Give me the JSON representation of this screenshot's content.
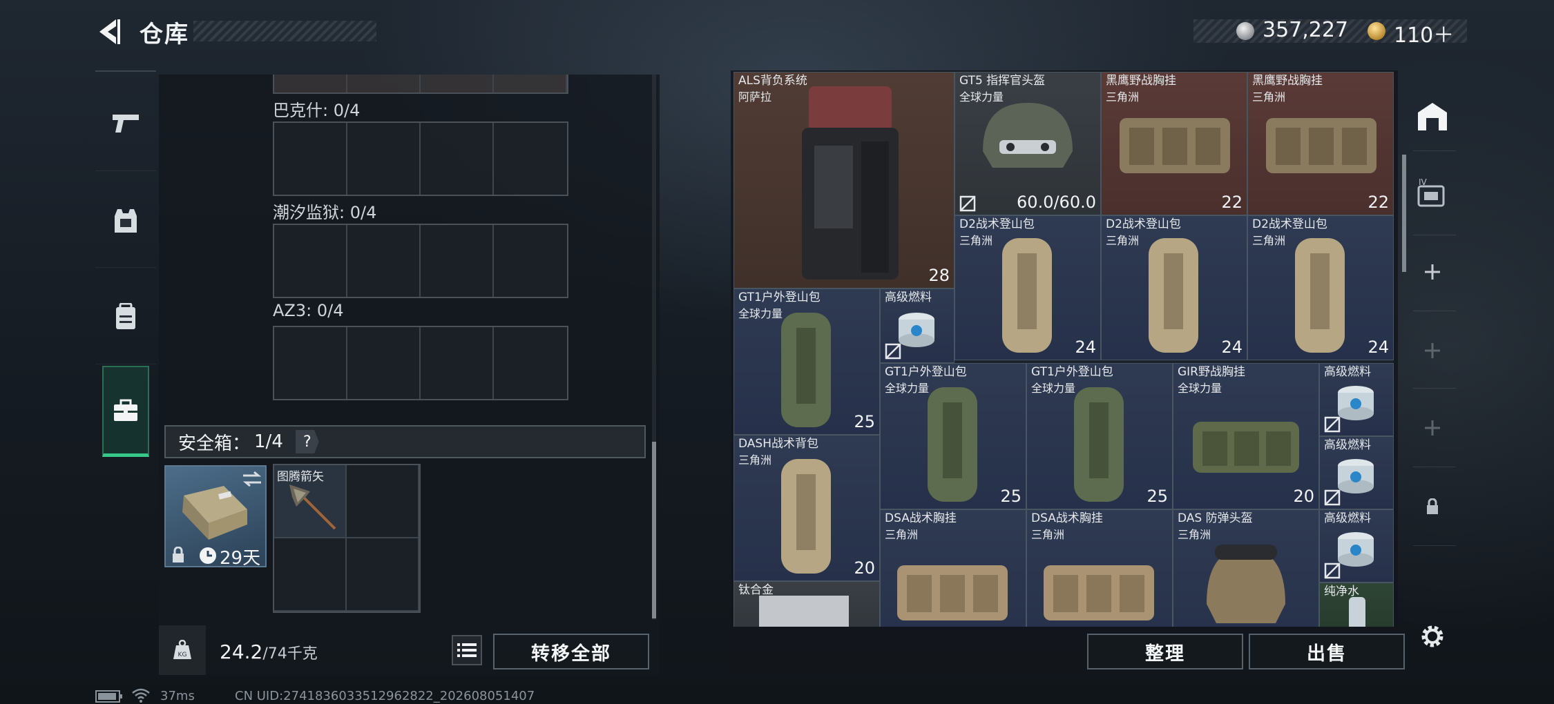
{
  "header": {
    "title": "仓库",
    "silver_amount": "357,227",
    "gold_amount": "110＋"
  },
  "nav": {
    "items": [
      "weapon-icon",
      "armor-icon",
      "backpack-icon",
      "case-icon"
    ],
    "active": "case-icon"
  },
  "containers": [
    {
      "label": "巴克什: 0/4"
    },
    {
      "label": "潮汐监狱: 0/4"
    },
    {
      "label": "AZ3: 0/4"
    }
  ],
  "safebox": {
    "label": "安全箱：",
    "count": "1/4",
    "help": "?",
    "duration": "29天",
    "item_name": "图腾箭矢"
  },
  "footer_left": {
    "weight": "24.2",
    "weight_max": "/74千克",
    "transfer_all": "转移全部"
  },
  "inventory": {
    "items": [
      {
        "name": "ALS背负系统",
        "sub": "阿萨拉",
        "value": "28"
      },
      {
        "name": "GT5 指挥官头盔",
        "sub": "全球力量",
        "value": "60.0/60.0"
      },
      {
        "name": "黑鹰野战胸挂",
        "sub": "三角洲",
        "value": "22"
      },
      {
        "name": "黑鹰野战胸挂",
        "sub": "三角洲",
        "value": "22"
      },
      {
        "name": "D2战术登山包",
        "sub": "三角洲",
        "value": "24"
      },
      {
        "name": "D2战术登山包",
        "sub": "三角洲",
        "value": "24"
      },
      {
        "name": "D2战术登山包",
        "sub": "三角洲",
        "value": "24"
      },
      {
        "name": "GT1户外登山包",
        "sub": "全球力量",
        "value": "25"
      },
      {
        "name": "高级燃料",
        "sub": "",
        "value": ""
      },
      {
        "name": "GT1户外登山包",
        "sub": "全球力量",
        "value": "25"
      },
      {
        "name": "GT1户外登山包",
        "sub": "全球力量",
        "value": "25"
      },
      {
        "name": "GIR野战胸挂",
        "sub": "全球力量",
        "value": "20"
      },
      {
        "name": "高级燃料",
        "sub": "",
        "value": ""
      },
      {
        "name": "DASH战术背包",
        "sub": "三角洲",
        "value": "20"
      },
      {
        "name": "高级燃料",
        "sub": "",
        "value": ""
      },
      {
        "name": "DSA战术胸挂",
        "sub": "三角洲",
        "value": ""
      },
      {
        "name": "DSA战术胸挂",
        "sub": "三角洲",
        "value": ""
      },
      {
        "name": "DAS 防弹头盔",
        "sub": "三角洲",
        "value": ""
      },
      {
        "name": "高级燃料",
        "sub": "",
        "value": ""
      },
      {
        "name": "钛合金",
        "sub": "",
        "value": ""
      },
      {
        "name": "纯净水",
        "sub": "",
        "value": ""
      }
    ]
  },
  "footer_right": {
    "sort": "整理",
    "sell": "出售"
  },
  "status": {
    "ping": "37ms",
    "uid": "CN UID:2741836033512962822_202608051407"
  },
  "colors": {
    "accent_green": "#37c98a",
    "rarity_blue": "#2f3b52",
    "rarity_red": "#5a3a36",
    "rarity_brown": "#503c34",
    "rarity_green": "#2e4434"
  }
}
